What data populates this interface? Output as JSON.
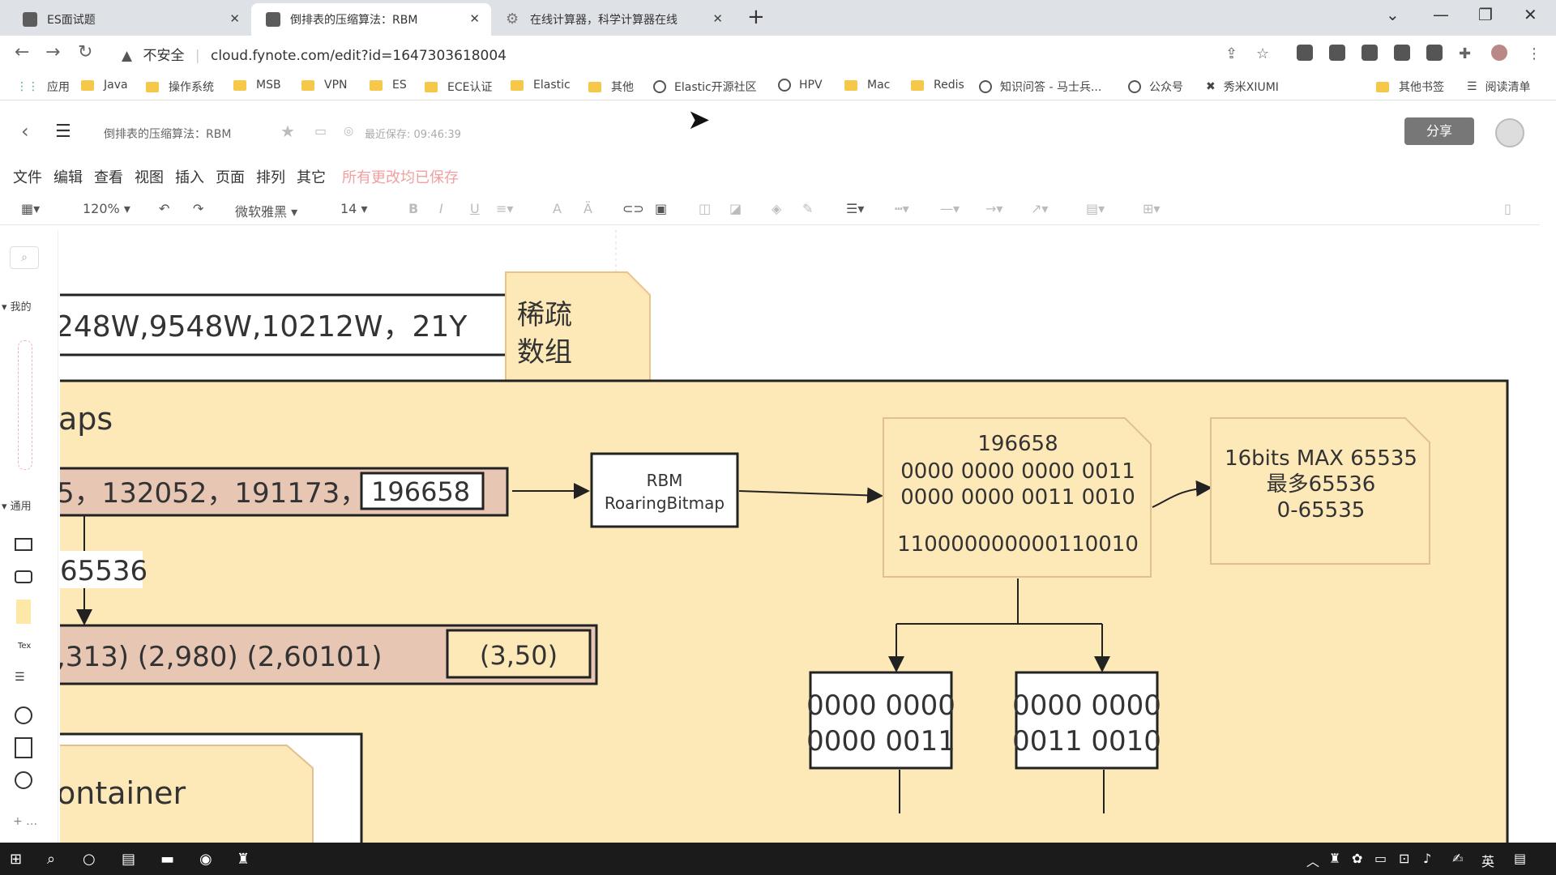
{
  "browser": {
    "tabs": [
      {
        "title": "ES面试题"
      },
      {
        "title": "倒排表的压缩算法：RBM"
      },
      {
        "title": "在线计算器，科学计算器在线"
      }
    ],
    "address": {
      "security": "不安全",
      "url": "cloud.fynote.com/edit?id=1647303618004"
    },
    "bookmarks": [
      "应用",
      "Java",
      "操作系统",
      "MSB",
      "VPN",
      "ES",
      "ECE认证",
      "Elastic",
      "其他",
      "Elastic开源社区",
      "HPV",
      "Mac",
      "Redis",
      "知识问答 - 马士兵...",
      "公众号",
      "秀米XIUMI",
      "其他书签",
      "阅读清单"
    ]
  },
  "app": {
    "doc_title": "倒排表的压缩算法：RBM",
    "last_saved": "最近保存: 09:46:39",
    "share_label": "分享",
    "menus": [
      "文件",
      "编辑",
      "查看",
      "视图",
      "插入",
      "页面",
      "排列",
      "其它"
    ],
    "save_status": "所有更改均已保存",
    "toolbar": {
      "zoom": "120%",
      "font": "微软雅黑",
      "font_size": "14"
    },
    "sidebar_labels": {
      "my": "我的",
      "general": "通用",
      "text": "Tex"
    }
  },
  "diagram": {
    "top_box": "248W,9548W,10212W，21Y",
    "note_sparse": [
      "稀疏",
      "数组"
    ],
    "section_title": "aps",
    "row1": "5，132052，191173，",
    "row1_highlight": "196658",
    "rbm_box": [
      "RBM",
      "RoaringBitmap"
    ],
    "binary_note": [
      "196658",
      "0000 0000 0000 0011",
      "0000 0000 0011 0010",
      "110000000000110010"
    ],
    "max_note": [
      "16bits MAX 65535",
      "最多65536",
      "0-65535"
    ],
    "label_65536": "65536",
    "row2": ",313)    (2,980)    (2,60101)",
    "row2_highlight": "(3,50)",
    "high_box": [
      "0000 0000",
      "0000 0011"
    ],
    "low_box": [
      "0000 0000",
      "0011 0010"
    ],
    "container_label": "ontainer"
  },
  "taskbar": {
    "lang": "英"
  }
}
